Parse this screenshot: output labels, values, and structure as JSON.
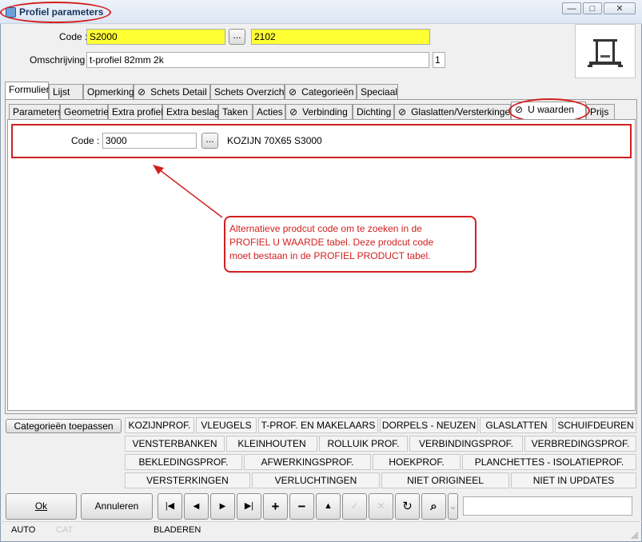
{
  "window": {
    "title": "Profiel parameters",
    "controls": {
      "minimize": "—",
      "maximize": "□",
      "close": "✕"
    }
  },
  "header": {
    "code_label": "Code :",
    "code_value": "S2000",
    "code_browse": "...",
    "code_value2": "2102",
    "desc_label": "Omschrijving :",
    "desc_value": "t-profiel 82mm 2k",
    "desc_number": "1"
  },
  "main_tabs": [
    {
      "label": "Formulier",
      "clip": false,
      "active": true
    },
    {
      "label": "Lijst",
      "clip": false
    },
    {
      "label": "Opmerking",
      "clip": false
    },
    {
      "label": "Schets Detail",
      "clip": true
    },
    {
      "label": "Schets Overzicht",
      "clip": false
    },
    {
      "label": "Categorieën",
      "clip": true
    },
    {
      "label": "Speciaal",
      "clip": false
    }
  ],
  "sub_tabs": [
    {
      "label": "Parameters"
    },
    {
      "label": "Geometrie"
    },
    {
      "label": "Extra profiel"
    },
    {
      "label": "Extra beslag"
    },
    {
      "label": "Taken"
    },
    {
      "label": "Acties"
    },
    {
      "label": "Verbinding",
      "clip": true
    },
    {
      "label": "Dichting"
    },
    {
      "label": "Glaslatten/Versterkingen",
      "clip": true
    },
    {
      "label": "U waarden",
      "clip": true,
      "active": true
    },
    {
      "label": "Prijs"
    }
  ],
  "u_values": {
    "code_label": "Code :",
    "code_value": "3000",
    "browse": "...",
    "description": "KOZIJN 70X65 S3000"
  },
  "annotation": {
    "line1": "Alternatieve prodcut code om te zoeken in de",
    "line2": "PROFIEL U WAARDE tabel. Deze prodcut code",
    "line3": "moet bestaan in de PROFIEL PRODUCT tabel."
  },
  "categories": {
    "apply_button": "Categorieën toepassen",
    "rows": [
      [
        "KOZIJNPROF.",
        "VLEUGELS",
        "T-PROF. EN MAKELAARS",
        "DORPELS - NEUZEN",
        "GLASLATTEN",
        "SCHUIFDEUREN"
      ],
      [
        "VENSTERBANKEN",
        "KLEINHOUTEN",
        "ROLLUIK PROF.",
        "VERBINDINGSPROF.",
        "VERBREDINGSPROF."
      ],
      [
        "BEKLEDINGSPROF.",
        "AFWERKINGSPROF.",
        "HOEKPROF.",
        "PLANCHETTES - ISOLATIEPROF."
      ],
      [
        "VERSTERKINGEN",
        "VERLUCHTINGEN",
        "NIET ORIGINEEL",
        "NIET IN UPDATES"
      ]
    ]
  },
  "footer": {
    "ok": "Ok",
    "cancel": "Annuleren",
    "nav": {
      "first": "|◀",
      "prev": "◀",
      "next": "▶",
      "last": "▶|",
      "add": "+",
      "remove": "−",
      "up": "▲",
      "confirm": "✓",
      "discard": "✕",
      "refresh": "↻",
      "find": "⌕",
      "dropdown": "⌄"
    },
    "search_value": "",
    "status_auto": "AUTO",
    "status_cat": "CAT",
    "status_mode": "BLADEREN"
  },
  "colors": {
    "highlight": "#ffff33",
    "annotation": "#d21f1f"
  }
}
